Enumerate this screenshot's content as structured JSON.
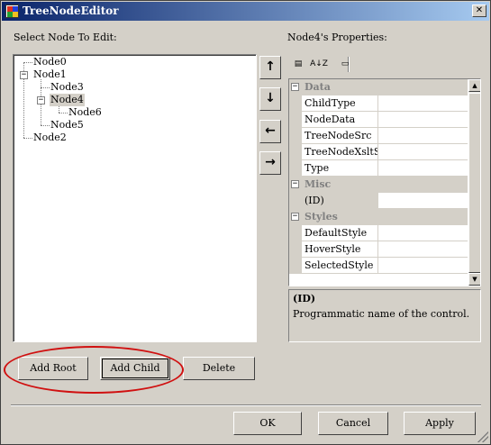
{
  "window": {
    "title": "TreeNodeEditor",
    "close_glyph": "✕"
  },
  "left": {
    "label": "Select Node To Edit:",
    "tree": [
      {
        "label": "Node0",
        "selected": false
      },
      {
        "label": "Node1",
        "selected": false,
        "expander": "−"
      },
      {
        "label": "Node3",
        "selected": false
      },
      {
        "label": "Node4",
        "selected": true,
        "expander": "−"
      },
      {
        "label": "Node6",
        "selected": false
      },
      {
        "label": "Node5",
        "selected": false
      },
      {
        "label": "Node2",
        "selected": false
      }
    ],
    "move_buttons": [
      {
        "name": "move-up-button",
        "icon": "arrow-up-icon",
        "glyph": "↑"
      },
      {
        "name": "move-down-button",
        "icon": "arrow-down-icon",
        "glyph": "↓"
      },
      {
        "name": "move-left-button",
        "icon": "arrow-left-icon",
        "glyph": "←"
      },
      {
        "name": "move-right-button",
        "icon": "arrow-right-icon",
        "glyph": "→"
      }
    ],
    "add_root_label": "Add Root",
    "add_child_label": "Add Child",
    "delete_label": "Delete"
  },
  "right": {
    "label": "Node4's Properties:",
    "toolbar": {
      "categorized_glyph": "▤",
      "alphabetical_glyph": "A↓Z",
      "property_pages_glyph": "▭"
    },
    "categories": [
      {
        "name": "Data",
        "sign": "−",
        "properties": [
          "ChildType",
          "NodeData",
          "TreeNodeSrc",
          "TreeNodeXsltSrc",
          "Type"
        ]
      },
      {
        "name": "Misc",
        "sign": "−",
        "properties": [
          "(ID)"
        ]
      },
      {
        "name": "Styles",
        "sign": "−",
        "properties": [
          "DefaultStyle",
          "HoverStyle",
          "SelectedStyle"
        ]
      }
    ],
    "selected_property": "(ID)",
    "scroll_up_glyph": "▲",
    "scroll_down_glyph": "▼",
    "description": {
      "title": "(ID)",
      "text": "Programmatic name of the control."
    }
  },
  "footer": {
    "ok_label": "OK",
    "cancel_label": "Cancel",
    "apply_label": "Apply"
  },
  "colors": {
    "annotation": "#d01010",
    "titlebar_start": "#0a246a",
    "titlebar_end": "#a6caf0",
    "face": "#d4d0c8"
  }
}
